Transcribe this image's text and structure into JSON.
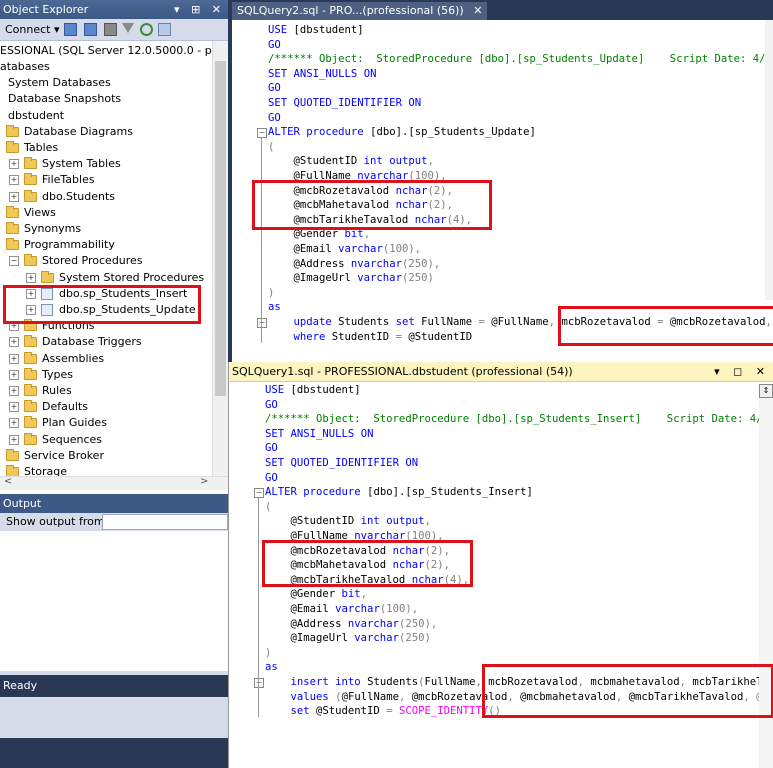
{
  "object_explorer": {
    "title": "Object Explorer",
    "title_buttons": "▾ ⊞ ✕",
    "connect_label": "Connect ▾",
    "server_node": "ESSIONAL (SQL Server 12.0.5000.0 - professio",
    "tree": [
      {
        "label": "atabases",
        "expander": ""
      },
      {
        "label": "System Databases",
        "expander": ""
      },
      {
        "label": "Database Snapshots",
        "expander": ""
      },
      {
        "label": "dbstudent",
        "expander": ""
      },
      {
        "label": "Database Diagrams",
        "expander": ""
      },
      {
        "label": "Tables",
        "expander": ""
      },
      {
        "label": "System Tables",
        "expander": "+"
      },
      {
        "label": "FileTables",
        "expander": "+"
      },
      {
        "label": "dbo.Students",
        "expander": "+"
      },
      {
        "label": "Views",
        "expander": ""
      },
      {
        "label": "Synonyms",
        "expander": ""
      },
      {
        "label": "Programmability",
        "expander": ""
      },
      {
        "label": "Stored Procedures",
        "expander": "−"
      },
      {
        "label": "System Stored Procedures",
        "expander": "+"
      },
      {
        "label": "dbo.sp_Students_Insert",
        "expander": "+"
      },
      {
        "label": "dbo.sp_Students_Update",
        "expander": "+"
      },
      {
        "label": "Functions",
        "expander": "+"
      },
      {
        "label": "Database Triggers",
        "expander": "+"
      },
      {
        "label": "Assemblies",
        "expander": "+"
      },
      {
        "label": "Types",
        "expander": "+"
      },
      {
        "label": "Rules",
        "expander": "+"
      },
      {
        "label": "Defaults",
        "expander": "+"
      },
      {
        "label": "Plan Guides",
        "expander": "+"
      },
      {
        "label": "Sequences",
        "expander": "+"
      },
      {
        "label": "Service Broker",
        "expander": ""
      },
      {
        "label": "Storage",
        "expander": ""
      }
    ],
    "hscroll_left": "<",
    "hscroll_right": ">"
  },
  "output": {
    "title": "Output",
    "show_output_from": "Show output from:",
    "selected": ""
  },
  "status": "Ready",
  "editor_top": {
    "tab_label": "SQLQuery2.sql - PRO...(professional (56))",
    "tab_close": "✕",
    "lines": [
      [
        {
          "t": "USE ",
          "c": "kw"
        },
        {
          "t": "[dbstudent]",
          "c": "tx"
        }
      ],
      [
        {
          "t": "GO",
          "c": "kw"
        }
      ],
      [
        {
          "t": "/****** Object:  StoredProcedure [dbo].[sp_Students_Update]    Script Date: 4/2",
          "c": "cm"
        }
      ],
      [
        {
          "t": "SET ",
          "c": "kw"
        },
        {
          "t": "ANSI_NULLS ",
          "c": "kw"
        },
        {
          "t": "ON",
          "c": "kw"
        }
      ],
      [
        {
          "t": "GO",
          "c": "kw"
        }
      ],
      [
        {
          "t": "SET ",
          "c": "kw"
        },
        {
          "t": "QUOTED_IDENTIFIER ",
          "c": "kw"
        },
        {
          "t": "ON",
          "c": "kw"
        }
      ],
      [
        {
          "t": "GO",
          "c": "kw"
        }
      ],
      [
        {
          "t": "ALTER ",
          "c": "kw"
        },
        {
          "t": "procedure ",
          "c": "kw"
        },
        {
          "t": "[dbo].[sp_Students_Update]",
          "c": "tx"
        }
      ],
      [
        {
          "t": "(",
          "c": "gr"
        }
      ],
      [
        {
          "t": "    @StudentID ",
          "c": "tx"
        },
        {
          "t": "int ",
          "c": "kw"
        },
        {
          "t": "output",
          "c": "kw"
        },
        {
          "t": ",",
          "c": "gr"
        }
      ],
      [
        {
          "t": "    @FullName ",
          "c": "tx"
        },
        {
          "t": "nvarchar",
          "c": "kw"
        },
        {
          "t": "(100)",
          "c": "gr"
        },
        {
          "t": ",",
          "c": "gr"
        }
      ],
      [
        {
          "t": "    @mcbRozetavalod ",
          "c": "tx"
        },
        {
          "t": "nchar",
          "c": "kw"
        },
        {
          "t": "(2)",
          "c": "gr"
        },
        {
          "t": ",",
          "c": "gr"
        }
      ],
      [
        {
          "t": "    @mcbMahetavalod ",
          "c": "tx"
        },
        {
          "t": "nchar",
          "c": "kw"
        },
        {
          "t": "(2)",
          "c": "gr"
        },
        {
          "t": ",",
          "c": "gr"
        }
      ],
      [
        {
          "t": "    @mcbTarikheTavalod ",
          "c": "tx"
        },
        {
          "t": "nchar",
          "c": "kw"
        },
        {
          "t": "(4)",
          "c": "gr"
        },
        {
          "t": ",",
          "c": "gr"
        }
      ],
      [
        {
          "t": "    @Gender ",
          "c": "tx"
        },
        {
          "t": "bit",
          "c": "kw"
        },
        {
          "t": ",",
          "c": "gr"
        }
      ],
      [
        {
          "t": "    @Email ",
          "c": "tx"
        },
        {
          "t": "varchar",
          "c": "kw"
        },
        {
          "t": "(100)",
          "c": "gr"
        },
        {
          "t": ",",
          "c": "gr"
        }
      ],
      [
        {
          "t": "    @Address ",
          "c": "tx"
        },
        {
          "t": "nvarchar",
          "c": "kw"
        },
        {
          "t": "(250)",
          "c": "gr"
        },
        {
          "t": ",",
          "c": "gr"
        }
      ],
      [
        {
          "t": "    @ImageUrl ",
          "c": "tx"
        },
        {
          "t": "varchar",
          "c": "kw"
        },
        {
          "t": "(250)",
          "c": "gr"
        }
      ],
      [
        {
          "t": ")",
          "c": "gr"
        }
      ],
      [
        {
          "t": "as",
          "c": "kw"
        }
      ],
      [
        {
          "t": "    update ",
          "c": "kw"
        },
        {
          "t": "Students ",
          "c": "tx"
        },
        {
          "t": "set ",
          "c": "kw"
        },
        {
          "t": "FullName ",
          "c": "tx"
        },
        {
          "t": "= ",
          "c": "gr"
        },
        {
          "t": "@FullName",
          "c": "tx"
        },
        {
          "t": ", ",
          "c": "gr"
        },
        {
          "t": "mcbRozetavalod ",
          "c": "tx"
        },
        {
          "t": "= ",
          "c": "gr"
        },
        {
          "t": "@mcbRozetavalod",
          "c": "tx"
        },
        {
          "t": ",",
          "c": "gr"
        }
      ],
      [
        {
          "t": "    where ",
          "c": "kw"
        },
        {
          "t": "StudentID ",
          "c": "tx"
        },
        {
          "t": "= ",
          "c": "gr"
        },
        {
          "t": "@StudentID",
          "c": "tx"
        }
      ]
    ]
  },
  "editor_bottom": {
    "title": "SQLQuery1.sql - PROFESSIONAL.dbstudent (professional (54))",
    "title_buttons": "▾ ◻ ✕",
    "lines": [
      [
        {
          "t": "USE ",
          "c": "kw"
        },
        {
          "t": "[dbstudent]",
          "c": "tx"
        }
      ],
      [
        {
          "t": "GO",
          "c": "kw"
        }
      ],
      [
        {
          "t": "/****** Object:  StoredProcedure [dbo].[sp_Students_Insert]    Script Date: 4/",
          "c": "cm"
        }
      ],
      [
        {
          "t": "SET ",
          "c": "kw"
        },
        {
          "t": "ANSI_NULLS ",
          "c": "kw"
        },
        {
          "t": "ON",
          "c": "kw"
        }
      ],
      [
        {
          "t": "GO",
          "c": "kw"
        }
      ],
      [
        {
          "t": "SET ",
          "c": "kw"
        },
        {
          "t": "QUOTED_IDENTIFIER ",
          "c": "kw"
        },
        {
          "t": "ON",
          "c": "kw"
        }
      ],
      [
        {
          "t": "GO",
          "c": "kw"
        }
      ],
      [
        {
          "t": "ALTER ",
          "c": "kw"
        },
        {
          "t": "procedure ",
          "c": "kw"
        },
        {
          "t": "[dbo].[sp_Students_Insert]",
          "c": "tx"
        }
      ],
      [
        {
          "t": "(",
          "c": "gr"
        }
      ],
      [
        {
          "t": "    @StudentID ",
          "c": "tx"
        },
        {
          "t": "int ",
          "c": "kw"
        },
        {
          "t": "output",
          "c": "kw"
        },
        {
          "t": ",",
          "c": "gr"
        }
      ],
      [
        {
          "t": "    @FullName ",
          "c": "tx"
        },
        {
          "t": "nvarchar",
          "c": "kw"
        },
        {
          "t": "(100)",
          "c": "gr"
        },
        {
          "t": ",",
          "c": "gr"
        }
      ],
      [
        {
          "t": "    @mcbRozetavalod ",
          "c": "tx"
        },
        {
          "t": "nchar",
          "c": "kw"
        },
        {
          "t": "(2)",
          "c": "gr"
        },
        {
          "t": ",",
          "c": "gr"
        }
      ],
      [
        {
          "t": "    @mcbMahetavalod ",
          "c": "tx"
        },
        {
          "t": "nchar",
          "c": "kw"
        },
        {
          "t": "(2)",
          "c": "gr"
        },
        {
          "t": ",",
          "c": "gr"
        }
      ],
      [
        {
          "t": "    @mcbTarikheTavalod ",
          "c": "tx"
        },
        {
          "t": "nchar",
          "c": "kw"
        },
        {
          "t": "(4)",
          "c": "gr"
        },
        {
          "t": ",",
          "c": "gr"
        }
      ],
      [
        {
          "t": "    @Gender ",
          "c": "tx"
        },
        {
          "t": "bit",
          "c": "kw"
        },
        {
          "t": ",",
          "c": "gr"
        }
      ],
      [
        {
          "t": "    @Email ",
          "c": "tx"
        },
        {
          "t": "varchar",
          "c": "kw"
        },
        {
          "t": "(100)",
          "c": "gr"
        },
        {
          "t": ",",
          "c": "gr"
        }
      ],
      [
        {
          "t": "    @Address ",
          "c": "tx"
        },
        {
          "t": "nvarchar",
          "c": "kw"
        },
        {
          "t": "(250)",
          "c": "gr"
        },
        {
          "t": ",",
          "c": "gr"
        }
      ],
      [
        {
          "t": "    @ImageUrl ",
          "c": "tx"
        },
        {
          "t": "varchar",
          "c": "kw"
        },
        {
          "t": "(250)",
          "c": "gr"
        }
      ],
      [
        {
          "t": ")",
          "c": "gr"
        }
      ],
      [
        {
          "t": "as",
          "c": "kw"
        }
      ],
      [
        {
          "t": "    insert into ",
          "c": "kw"
        },
        {
          "t": "Students",
          "c": "tx"
        },
        {
          "t": "(",
          "c": "gr"
        },
        {
          "t": "FullName",
          "c": "tx"
        },
        {
          "t": ", ",
          "c": "gr"
        },
        {
          "t": "mcbRozetavalod",
          "c": "tx"
        },
        {
          "t": ", ",
          "c": "gr"
        },
        {
          "t": "mcbmahetavalod",
          "c": "tx"
        },
        {
          "t": ", ",
          "c": "gr"
        },
        {
          "t": "mcbTarikheT",
          "c": "tx"
        }
      ],
      [
        {
          "t": "    values ",
          "c": "kw"
        },
        {
          "t": "(",
          "c": "gr"
        },
        {
          "t": "@FullName",
          "c": "tx"
        },
        {
          "t": ", ",
          "c": "gr"
        },
        {
          "t": "@mcbRozetavalod",
          "c": "tx"
        },
        {
          "t": ", ",
          "c": "gr"
        },
        {
          "t": "@mcbmahetavalod",
          "c": "tx"
        },
        {
          "t": ", ",
          "c": "gr"
        },
        {
          "t": "@mcbTarikheTavalod",
          "c": "tx"
        },
        {
          "t": ", @",
          "c": "gr"
        }
      ],
      [
        {
          "t": "    set ",
          "c": "kw"
        },
        {
          "t": "@StudentID ",
          "c": "tx"
        },
        {
          "t": "= ",
          "c": "gr"
        },
        {
          "t": "SCOPE_IDENTITY",
          "c": "fn"
        },
        {
          "t": "()",
          "c": "gr"
        }
      ]
    ]
  },
  "colors": {
    "highlight_box": "#e0101a",
    "keyword": "#0000ff",
    "comment": "#008000",
    "chrome_dark": "#293955",
    "active_tab_title": "#fdf4bf"
  }
}
